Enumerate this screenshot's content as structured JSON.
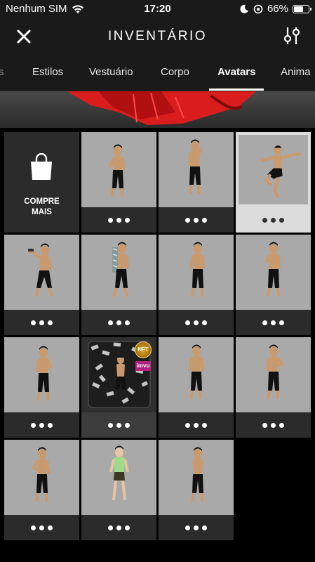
{
  "status": {
    "carrier": "Nenhum SIM",
    "time": "17:20",
    "battery": "66%",
    "battery_level": 0.66
  },
  "header": {
    "title": "INVENTÁRIO"
  },
  "tabs": [
    {
      "label": "s"
    },
    {
      "label": "Estilos"
    },
    {
      "label": "Vestuário"
    },
    {
      "label": "Corpo"
    },
    {
      "label": "Avatars",
      "active": true
    },
    {
      "label": "Anima"
    }
  ],
  "shop": {
    "line1": "COMPRE",
    "line2": "MAIS"
  },
  "nft": {
    "badge": "NFT",
    "brand": "imvu"
  },
  "colors": {
    "thumb_bg": "#a9a9a9",
    "cell_bg": "#2b2b2b",
    "selected_bg": "#dcdcdc",
    "shirt_green": "#9fd98a"
  }
}
